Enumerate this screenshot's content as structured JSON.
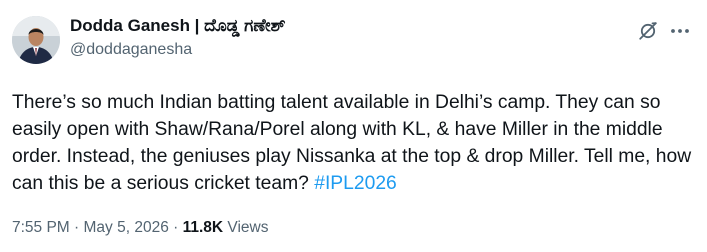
{
  "author": {
    "display_name": "Dodda Ganesh | ದೊಡ್ಡ ಗಣೇಶ್",
    "handle": "@doddaganesha"
  },
  "icons": {
    "avatar": "avatar",
    "grok": "grok-icon",
    "more": "more-icon"
  },
  "tweet": {
    "text_before_hashtag": "There’s so much Indian batting talent available in Delhi’s camp. They can so easily open with Shaw/Rana/Porel along with KL, & have Miller in the middle order. Instead, the geniuses play Nissanka at the top & drop Miller. Tell me, how can this be a serious cricket team? ",
    "hashtag": "#IPL2026"
  },
  "meta": {
    "time": "7:55 PM",
    "separator_1": " · ",
    "date": "May 5, 2026",
    "separator_2": " · ",
    "views_count": "11.8K",
    "views_label": " Views"
  },
  "colors": {
    "text": "#0f1419",
    "secondary": "#536471",
    "link": "#1d9bf0"
  }
}
